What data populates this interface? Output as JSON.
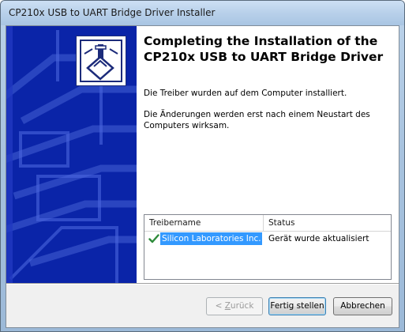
{
  "window": {
    "title": "CP210x USB to UART Bridge Driver Installer"
  },
  "sidebar": {
    "logo_icon": "usb-installer-icon"
  },
  "main": {
    "heading": "Completing the Installation of the CP210x USB to UART Bridge Driver",
    "paragraph1": "Die Treiber wurden auf dem Computer installiert.",
    "paragraph2": "Die Änderungen werden erst nach einem Neustart des Computers wirksam."
  },
  "driver_list": {
    "columns": [
      "Treibername",
      "Status"
    ],
    "rows": [
      {
        "icon": "checkmark-icon",
        "name": "Silicon Laboratories Inc. ...",
        "status": "Gerät wurde aktualisiert"
      }
    ]
  },
  "buttons": {
    "back_prefix": "< ",
    "back_mnemonic": "Z",
    "back_rest": "urück",
    "finish": "Fertig stellen",
    "cancel": "Abbrechen"
  },
  "colors": {
    "sidebar_blue": "#0a24a8",
    "selection_blue": "#3399ff",
    "checkmark_green": "#2e8b3a"
  }
}
